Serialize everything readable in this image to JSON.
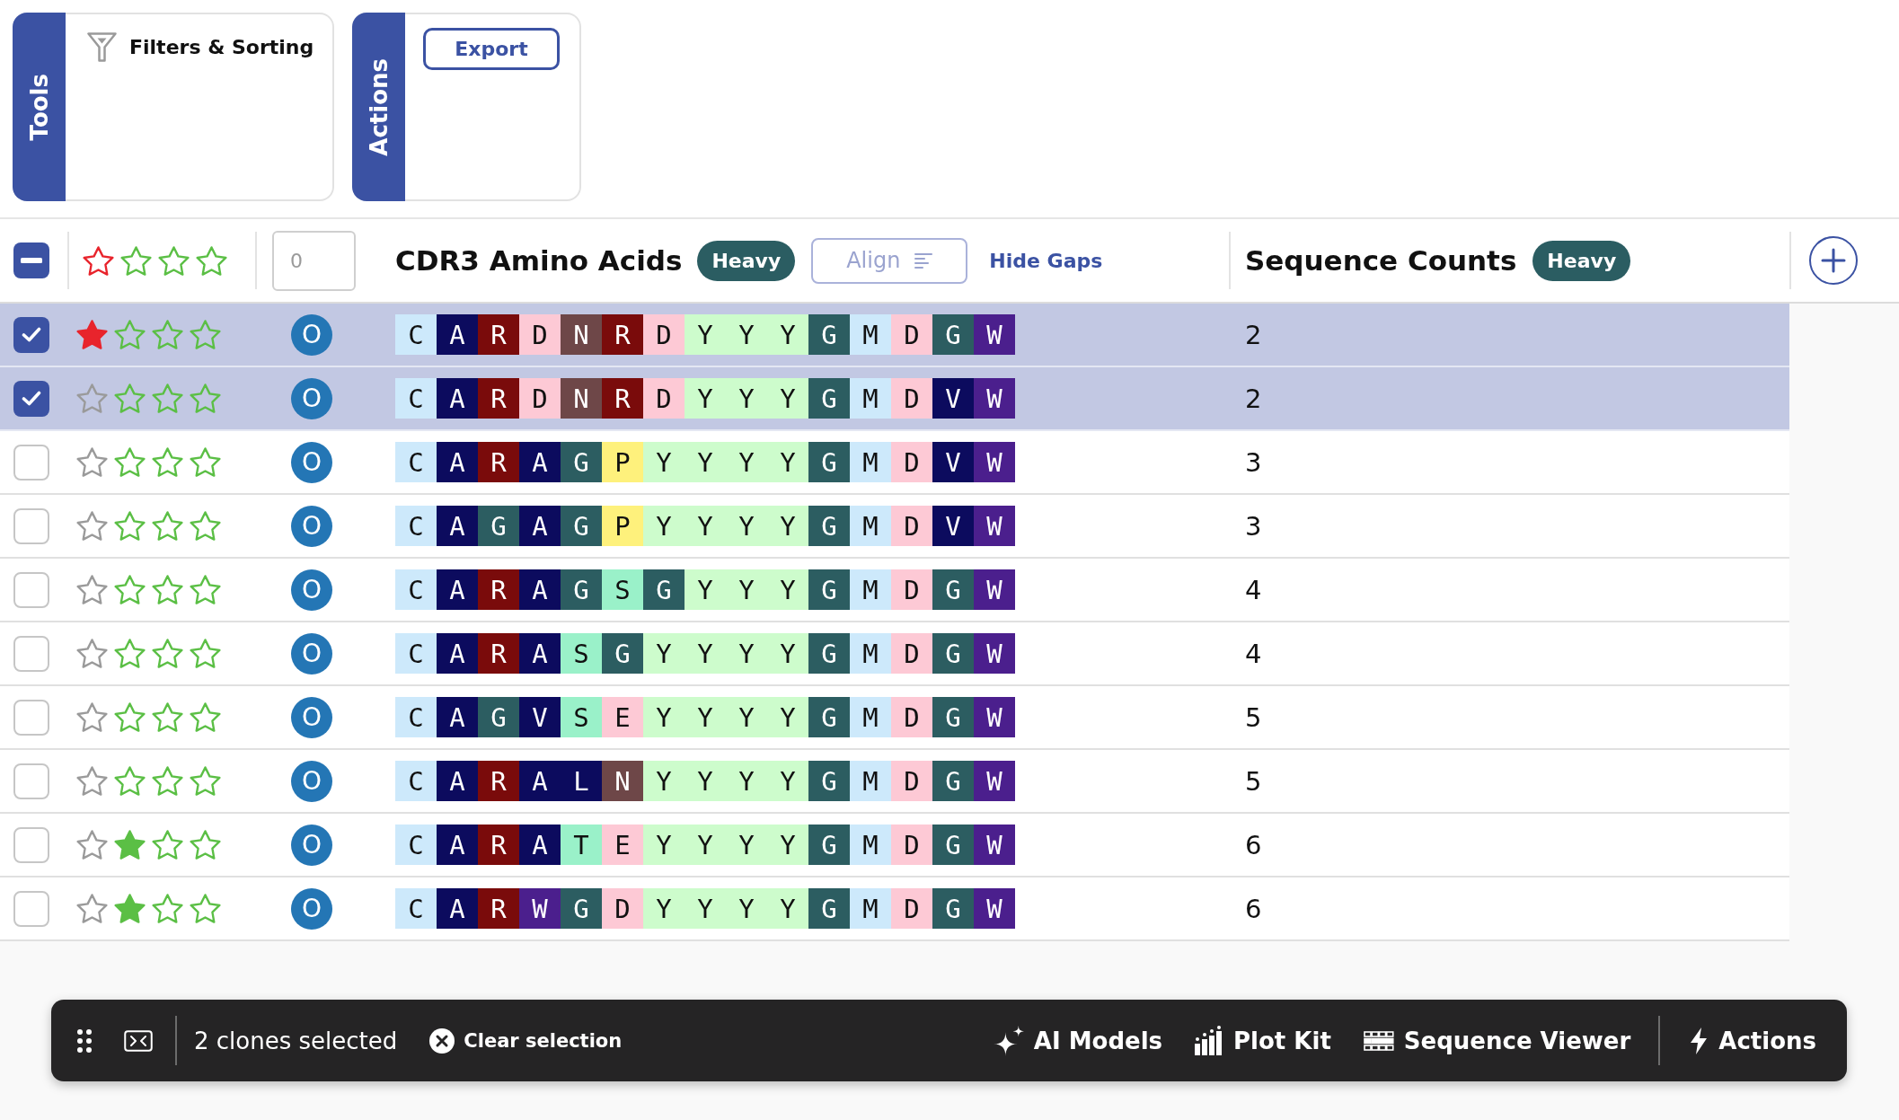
{
  "panels": [
    {
      "kind": "filter",
      "tab": "Tools",
      "label": "Filters & Sorting"
    },
    {
      "kind": "button",
      "tab": "Actions",
      "label": "Export"
    }
  ],
  "table": {
    "select_all": {
      "indeterminate": true
    },
    "count_filter": {
      "placeholder": "0"
    },
    "sequence_column": {
      "title": "CDR3 Amino Acids",
      "chain": "Heavy",
      "align_button": {
        "label": "Align",
        "disabled": true
      },
      "gaps_link": "Hide Gaps"
    },
    "count_column": {
      "title": "Sequence Counts",
      "chain": "Heavy"
    },
    "rows": [
      {
        "selected": true,
        "flagged": true,
        "stars": 0,
        "badge": "O",
        "count": "2",
        "residues": [
          {
            "aa": "C",
            "color": "#cde9fb"
          },
          {
            "aa": "A",
            "color": "#0c0b5e"
          },
          {
            "aa": "R",
            "color": "#7a0b0b"
          },
          {
            "aa": "D",
            "color": "#fdc9d5"
          },
          {
            "aa": "N",
            "color": "#6e4748"
          },
          {
            "aa": "R",
            "color": "#7a0b0b"
          },
          {
            "aa": "D",
            "color": "#fdc9d5"
          },
          {
            "aa": "Y",
            "color": "#cdfccc"
          },
          {
            "aa": "Y",
            "color": "#cdfccc"
          },
          {
            "aa": "Y",
            "color": "#cdfccc"
          },
          {
            "aa": "G",
            "color": "#2c5d61"
          },
          {
            "aa": "M",
            "color": "#cde9fb"
          },
          {
            "aa": "D",
            "color": "#fdc9d5"
          },
          {
            "aa": "G",
            "color": "#2c5d61"
          },
          {
            "aa": "W",
            "color": "#4b1f8d"
          }
        ]
      },
      {
        "selected": true,
        "flagged": false,
        "stars": 0,
        "badge": "O",
        "count": "2",
        "residues": [
          {
            "aa": "C",
            "color": "#cde9fb"
          },
          {
            "aa": "A",
            "color": "#0c0b5e"
          },
          {
            "aa": "R",
            "color": "#7a0b0b"
          },
          {
            "aa": "D",
            "color": "#fdc9d5"
          },
          {
            "aa": "N",
            "color": "#6e4748"
          },
          {
            "aa": "R",
            "color": "#7a0b0b"
          },
          {
            "aa": "D",
            "color": "#fdc9d5"
          },
          {
            "aa": "Y",
            "color": "#cdfccc"
          },
          {
            "aa": "Y",
            "color": "#cdfccc"
          },
          {
            "aa": "Y",
            "color": "#cdfccc"
          },
          {
            "aa": "G",
            "color": "#2c5d61"
          },
          {
            "aa": "M",
            "color": "#cde9fb"
          },
          {
            "aa": "D",
            "color": "#fdc9d5"
          },
          {
            "aa": "V",
            "color": "#0c0b5e"
          },
          {
            "aa": "W",
            "color": "#4b1f8d"
          }
        ]
      },
      {
        "selected": false,
        "flagged": false,
        "stars": 0,
        "badge": "O",
        "count": "3",
        "residues": [
          {
            "aa": "C",
            "color": "#cde9fb"
          },
          {
            "aa": "A",
            "color": "#0c0b5e"
          },
          {
            "aa": "R",
            "color": "#7a0b0b"
          },
          {
            "aa": "A",
            "color": "#0c0b5e"
          },
          {
            "aa": "G",
            "color": "#2c5d61"
          },
          {
            "aa": "P",
            "color": "#fef17c"
          },
          {
            "aa": "Y",
            "color": "#cdfccc"
          },
          {
            "aa": "Y",
            "color": "#cdfccc"
          },
          {
            "aa": "Y",
            "color": "#cdfccc"
          },
          {
            "aa": "Y",
            "color": "#cdfccc"
          },
          {
            "aa": "G",
            "color": "#2c5d61"
          },
          {
            "aa": "M",
            "color": "#cde9fb"
          },
          {
            "aa": "D",
            "color": "#fdc9d5"
          },
          {
            "aa": "V",
            "color": "#0c0b5e"
          },
          {
            "aa": "W",
            "color": "#4b1f8d"
          }
        ]
      },
      {
        "selected": false,
        "flagged": false,
        "stars": 0,
        "badge": "O",
        "count": "3",
        "residues": [
          {
            "aa": "C",
            "color": "#cde9fb"
          },
          {
            "aa": "A",
            "color": "#0c0b5e"
          },
          {
            "aa": "G",
            "color": "#2c5d61"
          },
          {
            "aa": "A",
            "color": "#0c0b5e"
          },
          {
            "aa": "G",
            "color": "#2c5d61"
          },
          {
            "aa": "P",
            "color": "#fef17c"
          },
          {
            "aa": "Y",
            "color": "#cdfccc"
          },
          {
            "aa": "Y",
            "color": "#cdfccc"
          },
          {
            "aa": "Y",
            "color": "#cdfccc"
          },
          {
            "aa": "Y",
            "color": "#cdfccc"
          },
          {
            "aa": "G",
            "color": "#2c5d61"
          },
          {
            "aa": "M",
            "color": "#cde9fb"
          },
          {
            "aa": "D",
            "color": "#fdc9d5"
          },
          {
            "aa": "V",
            "color": "#0c0b5e"
          },
          {
            "aa": "W",
            "color": "#4b1f8d"
          }
        ]
      },
      {
        "selected": false,
        "flagged": false,
        "stars": 0,
        "badge": "O",
        "count": "4",
        "residues": [
          {
            "aa": "C",
            "color": "#cde9fb"
          },
          {
            "aa": "A",
            "color": "#0c0b5e"
          },
          {
            "aa": "R",
            "color": "#7a0b0b"
          },
          {
            "aa": "A",
            "color": "#0c0b5e"
          },
          {
            "aa": "G",
            "color": "#2c5d61"
          },
          {
            "aa": "S",
            "color": "#9af1c9"
          },
          {
            "aa": "G",
            "color": "#2c5d61"
          },
          {
            "aa": "Y",
            "color": "#cdfccc"
          },
          {
            "aa": "Y",
            "color": "#cdfccc"
          },
          {
            "aa": "Y",
            "color": "#cdfccc"
          },
          {
            "aa": "G",
            "color": "#2c5d61"
          },
          {
            "aa": "M",
            "color": "#cde9fb"
          },
          {
            "aa": "D",
            "color": "#fdc9d5"
          },
          {
            "aa": "G",
            "color": "#2c5d61"
          },
          {
            "aa": "W",
            "color": "#4b1f8d"
          }
        ]
      },
      {
        "selected": false,
        "flagged": false,
        "stars": 0,
        "badge": "O",
        "count": "4",
        "residues": [
          {
            "aa": "C",
            "color": "#cde9fb"
          },
          {
            "aa": "A",
            "color": "#0c0b5e"
          },
          {
            "aa": "R",
            "color": "#7a0b0b"
          },
          {
            "aa": "A",
            "color": "#0c0b5e"
          },
          {
            "aa": "S",
            "color": "#9af1c9"
          },
          {
            "aa": "G",
            "color": "#2c5d61"
          },
          {
            "aa": "Y",
            "color": "#cdfccc"
          },
          {
            "aa": "Y",
            "color": "#cdfccc"
          },
          {
            "aa": "Y",
            "color": "#cdfccc"
          },
          {
            "aa": "Y",
            "color": "#cdfccc"
          },
          {
            "aa": "G",
            "color": "#2c5d61"
          },
          {
            "aa": "M",
            "color": "#cde9fb"
          },
          {
            "aa": "D",
            "color": "#fdc9d5"
          },
          {
            "aa": "G",
            "color": "#2c5d61"
          },
          {
            "aa": "W",
            "color": "#4b1f8d"
          }
        ]
      },
      {
        "selected": false,
        "flagged": false,
        "stars": 0,
        "badge": "O",
        "count": "5",
        "residues": [
          {
            "aa": "C",
            "color": "#cde9fb"
          },
          {
            "aa": "A",
            "color": "#0c0b5e"
          },
          {
            "aa": "G",
            "color": "#2c5d61"
          },
          {
            "aa": "V",
            "color": "#0c0b5e"
          },
          {
            "aa": "S",
            "color": "#9af1c9"
          },
          {
            "aa": "E",
            "color": "#fdc9d5"
          },
          {
            "aa": "Y",
            "color": "#cdfccc"
          },
          {
            "aa": "Y",
            "color": "#cdfccc"
          },
          {
            "aa": "Y",
            "color": "#cdfccc"
          },
          {
            "aa": "Y",
            "color": "#cdfccc"
          },
          {
            "aa": "G",
            "color": "#2c5d61"
          },
          {
            "aa": "M",
            "color": "#cde9fb"
          },
          {
            "aa": "D",
            "color": "#fdc9d5"
          },
          {
            "aa": "G",
            "color": "#2c5d61"
          },
          {
            "aa": "W",
            "color": "#4b1f8d"
          }
        ]
      },
      {
        "selected": false,
        "flagged": false,
        "stars": 0,
        "badge": "O",
        "count": "5",
        "residues": [
          {
            "aa": "C",
            "color": "#cde9fb"
          },
          {
            "aa": "A",
            "color": "#0c0b5e"
          },
          {
            "aa": "R",
            "color": "#7a0b0b"
          },
          {
            "aa": "A",
            "color": "#0c0b5e"
          },
          {
            "aa": "L",
            "color": "#0c0b5e"
          },
          {
            "aa": "N",
            "color": "#6e4748"
          },
          {
            "aa": "Y",
            "color": "#cdfccc"
          },
          {
            "aa": "Y",
            "color": "#cdfccc"
          },
          {
            "aa": "Y",
            "color": "#cdfccc"
          },
          {
            "aa": "Y",
            "color": "#cdfccc"
          },
          {
            "aa": "G",
            "color": "#2c5d61"
          },
          {
            "aa": "M",
            "color": "#cde9fb"
          },
          {
            "aa": "D",
            "color": "#fdc9d5"
          },
          {
            "aa": "G",
            "color": "#2c5d61"
          },
          {
            "aa": "W",
            "color": "#4b1f8d"
          }
        ]
      },
      {
        "selected": false,
        "flagged": false,
        "stars": 1,
        "badge": "O",
        "count": "6",
        "residues": [
          {
            "aa": "C",
            "color": "#cde9fb"
          },
          {
            "aa": "A",
            "color": "#0c0b5e"
          },
          {
            "aa": "R",
            "color": "#7a0b0b"
          },
          {
            "aa": "A",
            "color": "#0c0b5e"
          },
          {
            "aa": "T",
            "color": "#9af1c9"
          },
          {
            "aa": "E",
            "color": "#fdc9d5"
          },
          {
            "aa": "Y",
            "color": "#cdfccc"
          },
          {
            "aa": "Y",
            "color": "#cdfccc"
          },
          {
            "aa": "Y",
            "color": "#cdfccc"
          },
          {
            "aa": "Y",
            "color": "#cdfccc"
          },
          {
            "aa": "G",
            "color": "#2c5d61"
          },
          {
            "aa": "M",
            "color": "#cde9fb"
          },
          {
            "aa": "D",
            "color": "#fdc9d5"
          },
          {
            "aa": "G",
            "color": "#2c5d61"
          },
          {
            "aa": "W",
            "color": "#4b1f8d"
          }
        ]
      },
      {
        "selected": false,
        "flagged": false,
        "stars": 1,
        "badge": "O",
        "count": "6",
        "residues": [
          {
            "aa": "C",
            "color": "#cde9fb"
          },
          {
            "aa": "A",
            "color": "#0c0b5e"
          },
          {
            "aa": "R",
            "color": "#7a0b0b"
          },
          {
            "aa": "W",
            "color": "#4b1f8d"
          },
          {
            "aa": "G",
            "color": "#2c5d61"
          },
          {
            "aa": "D",
            "color": "#fdc9d5"
          },
          {
            "aa": "Y",
            "color": "#cdfccc"
          },
          {
            "aa": "Y",
            "color": "#cdfccc"
          },
          {
            "aa": "Y",
            "color": "#cdfccc"
          },
          {
            "aa": "Y",
            "color": "#cdfccc"
          },
          {
            "aa": "G",
            "color": "#2c5d61"
          },
          {
            "aa": "M",
            "color": "#cde9fb"
          },
          {
            "aa": "D",
            "color": "#fdc9d5"
          },
          {
            "aa": "G",
            "color": "#2c5d61"
          },
          {
            "aa": "W",
            "color": "#4b1f8d"
          }
        ]
      }
    ]
  },
  "selection_bar": {
    "selected_text": "2 clones selected",
    "clear_label": "Clear selection",
    "tools": [
      {
        "kind": "ai",
        "label": "AI Models"
      },
      {
        "kind": "plot",
        "label": "Plot Kit"
      },
      {
        "kind": "viewer",
        "label": "Sequence Viewer"
      },
      {
        "kind": "actions",
        "label": "Actions"
      }
    ]
  }
}
